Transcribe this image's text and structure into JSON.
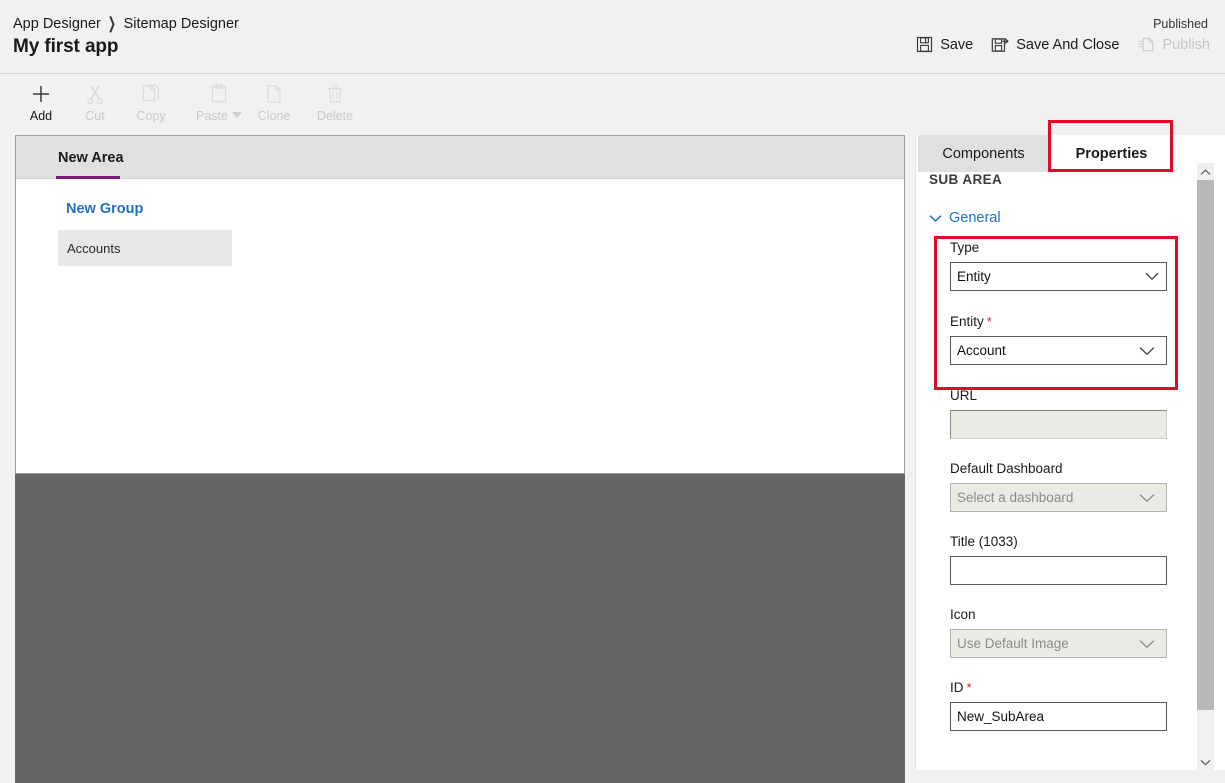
{
  "header": {
    "breadcrumb": [
      "App Designer",
      "Sitemap Designer"
    ],
    "title": "My first app",
    "published_status": "Published",
    "actions": [
      {
        "label": "Save",
        "icon": "save-icon",
        "disabled": false
      },
      {
        "label": "Save And Close",
        "icon": "save-and-close-icon",
        "disabled": false
      },
      {
        "label": "Publish",
        "icon": "publish-icon",
        "disabled": true
      }
    ]
  },
  "command_bar": {
    "items": [
      {
        "label": "Add",
        "icon": "plus-icon",
        "disabled": false,
        "caret": false
      },
      {
        "label": "Cut",
        "icon": "scissors-icon",
        "disabled": true,
        "caret": false
      },
      {
        "label": "Copy",
        "icon": "copy-icon",
        "disabled": true,
        "caret": false
      },
      {
        "label": "Paste",
        "icon": "clipboard-icon",
        "disabled": true,
        "caret": true
      },
      {
        "label": "Clone",
        "icon": "clone-icon",
        "disabled": true,
        "caret": false
      },
      {
        "label": "Delete",
        "icon": "trash-icon",
        "disabled": true,
        "caret": false
      }
    ]
  },
  "canvas": {
    "area_tab": "New Area",
    "group_title": "New Group",
    "subarea_tile": "Accounts",
    "area_underline_color": "#7b1f7b",
    "group_link_color": "#1f6fc4"
  },
  "right_panel": {
    "tabs": [
      {
        "label": "Components",
        "active": false
      },
      {
        "label": "Properties",
        "active": true
      }
    ],
    "section_header": "SUB AREA",
    "general_group": "General",
    "fields": {
      "type": {
        "label": "Type",
        "value": "Entity",
        "control": "select",
        "disabled": false,
        "required": false
      },
      "entity": {
        "label": "Entity",
        "value": "Account",
        "control": "select",
        "disabled": false,
        "required": true
      },
      "url": {
        "label": "URL",
        "value": "",
        "placeholder": "",
        "control": "input",
        "disabled": true,
        "required": false
      },
      "default_dashboard": {
        "label": "Default Dashboard",
        "value": "Select a dashboard",
        "control": "select",
        "disabled": true,
        "required": false
      },
      "title": {
        "label": "Title (1033)",
        "value": "",
        "placeholder": "",
        "control": "input",
        "disabled": false,
        "required": false
      },
      "icon": {
        "label": "Icon",
        "value": "Use Default Image",
        "control": "select",
        "disabled": true,
        "required": false
      },
      "id": {
        "label": "ID",
        "value": "New_SubArea",
        "control": "input",
        "disabled": false,
        "required": true
      }
    }
  },
  "annotations": {
    "color": "#e00b28",
    "boxes": [
      "properties-tab",
      "type-and-entity-fields"
    ]
  },
  "scrollbar": {
    "up_arrow": "chevron-up-icon",
    "down_arrow": "chevron-down-icon"
  }
}
